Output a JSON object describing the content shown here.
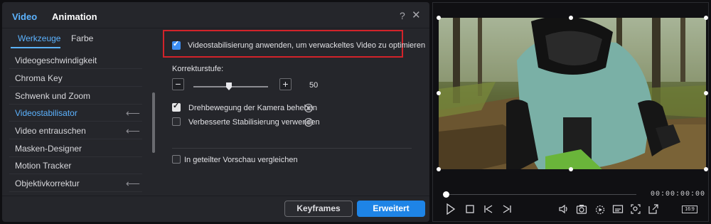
{
  "header": {
    "tabs": [
      {
        "label": "Video"
      },
      {
        "label": "Animation"
      }
    ],
    "help_glyph": "?",
    "close_glyph": "✕"
  },
  "subtabs": [
    {
      "label": "Werkzeuge"
    },
    {
      "label": "Farbe"
    }
  ],
  "tools": [
    {
      "label": "Videogeschwindigkeit"
    },
    {
      "label": "Chroma Key"
    },
    {
      "label": "Schwenk und Zoom"
    },
    {
      "label": "Videostabilisator",
      "active": true
    },
    {
      "label": "Video entrauschen"
    },
    {
      "label": "Masken-Designer"
    },
    {
      "label": "Motion Tracker"
    },
    {
      "label": "Objektivkorrektur"
    }
  ],
  "settings": {
    "apply_stab_label": "Videostabilisierung anwenden, um verwackeltes Video zu optimieren",
    "apply_stab_checked": true,
    "correction_label": "Korrekturstufe:",
    "correction_value": "50",
    "rolling_label": "Drehbewegung der Kamera beheben",
    "rolling_checked": true,
    "enhanced_label": "Verbesserte Stabilisierung verwenden",
    "enhanced_checked": false,
    "split_label": "In geteilter Vorschau vergleichen",
    "split_checked": false
  },
  "footer": {
    "keyframes_label": "Keyframes",
    "advanced_label": "Erweitert"
  },
  "player": {
    "timecode": "00:00:00:00",
    "aspect_label": "16:9"
  },
  "colors": {
    "accent": "#5cb3ff",
    "primary_button": "#1e84e6",
    "highlight_box": "#d2232a"
  }
}
